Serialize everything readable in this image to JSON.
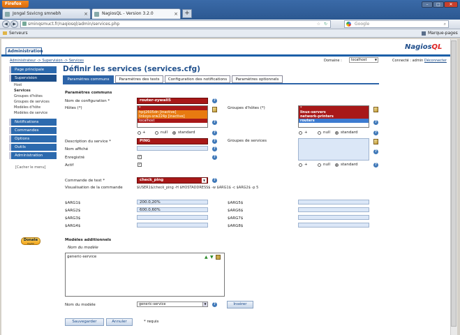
{
  "browser": {
    "menu_button": "Firefox",
    "tabs": [
      {
        "title": "Jongal Ssvicng smnebh"
      },
      {
        "title": "NagiosQL - Version 3.2.0"
      }
    ],
    "new_tab": "+",
    "url": "sminqsmuct.fr/naqiosql/admin/services.php",
    "search_placeholder": "Google",
    "bookmark": "Serveurs",
    "bookmarks_menu": "Marque-pages"
  },
  "app": {
    "top_tab": "Administration",
    "logo_left": "Nagios",
    "logo_right": "QL",
    "breadcrumb": "Administrateur -> Supervision -> Services",
    "domain_label": "Domaine :",
    "domain_value": "localhost",
    "connected_label": "Connecté : admin",
    "disconnect": "Déconnecter"
  },
  "sidebar": {
    "home": "Page principale",
    "supervision": "Supervision",
    "sub_items": [
      "Host",
      "Services",
      "Groupes d'hôtes",
      "Groupes de services",
      "Modèles d'hôte",
      "Modèles de service"
    ],
    "notifications": "Notifications",
    "commands": "Commandes",
    "options": "Options",
    "tools": "Outils",
    "administration": "Administration",
    "hide_menu": "[Cacher le menu]",
    "donate": "Donate",
    "donate_sub": "PayPal"
  },
  "main": {
    "title": "Définir les services (services.cfg)",
    "tabs": [
      "Paramètres communs",
      "Paramètres des tests",
      "Configuration des notifications",
      "Paramètres optionnels"
    ],
    "section_common": "Paramètres communs",
    "config_name_label": "Nom de configuration *",
    "config_name_value": "router-zywall5",
    "hosts_label": "Hôtes (*)",
    "hosts_list": [
      "*",
      "hpij2605dn [inactive]",
      "linksys-srw224p [inactive]",
      "localhost"
    ],
    "hostgroups_label": "Groupes d'hôtes (*)",
    "hostgroups_list": [
      "*",
      "linux-servers",
      "network-printers",
      "routers"
    ],
    "radio_plus": "+",
    "radio_null": "null",
    "radio_standard": "standard",
    "description_label": "Description du service *",
    "description_value": "PING",
    "servicegroups_label": "Groupes de services",
    "display_name_label": "Nom affiché",
    "registered_label": "Enregistré",
    "active_label": "Actif",
    "check_command_label": "Commande de test *",
    "check_command_value": "check_ping",
    "command_view_label": "Visualisation de la commande",
    "command_view_value": "$USER1$/check_ping -H $HOSTADDRESS$ -w $ARG1$ -c $ARG2$ -p 5",
    "args_left": [
      {
        "label": "$ARG1$",
        "value": "200.0,20%"
      },
      {
        "label": "$ARG2$",
        "value": "600.0,60%"
      },
      {
        "label": "$ARG3$",
        "value": ""
      },
      {
        "label": "$ARG4$",
        "value": ""
      }
    ],
    "args_right": [
      {
        "label": "$ARG5$",
        "value": ""
      },
      {
        "label": "$ARG6$",
        "value": ""
      },
      {
        "label": "$ARG7$",
        "value": ""
      },
      {
        "label": "$ARG8$",
        "value": ""
      }
    ],
    "section_templates": "Modèles additionnels",
    "template_name_header": "Nom du modèle",
    "template_entry": "generic-service",
    "template_name_label": "Nom du modèle",
    "template_select_value": "generic-service",
    "insert_button": "Insérer",
    "save_button": "Sauvegarder",
    "cancel_button": "Annuler",
    "required_note": "* requis"
  },
  "colors": {
    "accent": "#2d64a8",
    "required_field": "#a81818",
    "list_highlight": "#e87a10"
  }
}
